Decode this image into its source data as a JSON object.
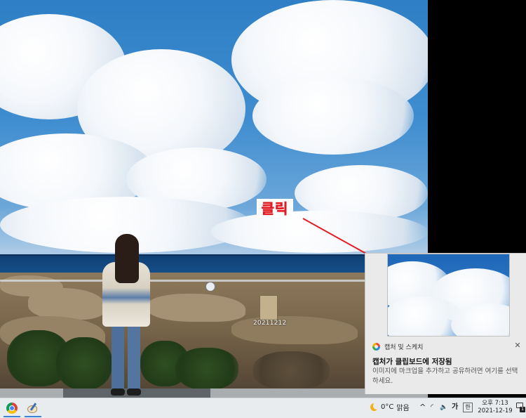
{
  "annotation": {
    "label": "클릭",
    "color": "#e21d24"
  },
  "desktop": {
    "photo_stamp": "20211212"
  },
  "toast": {
    "app_name": "캡처 및 스케치",
    "close_glyph": "✕",
    "title": "캡처가 클립보드에 저장됨",
    "body": "이미지에 마크업을 추가하고 공유하려면 여기를 선택하세요."
  },
  "taskbar": {
    "apps": [
      {
        "name": "chrome",
        "icon": "chrome-icon"
      },
      {
        "name": "paint",
        "icon": "paint-icon"
      }
    ],
    "weather": {
      "temp": "0°C",
      "condition": "맑음",
      "icon": "moon-icon"
    },
    "tray": {
      "chevron": "^",
      "network": "◜",
      "volume": "🔈",
      "ime_mode": "가",
      "ime_hangul": "한"
    },
    "clock": {
      "time": "오후 7:13",
      "date": "2021-12-19"
    },
    "notification_count": "1"
  }
}
